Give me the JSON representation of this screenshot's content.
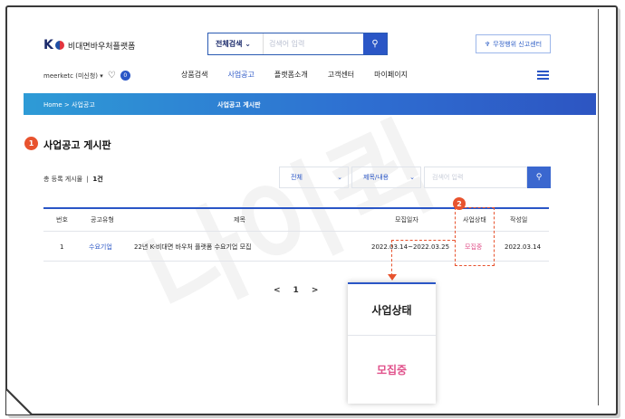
{
  "logo": {
    "text": "비대면바우처플랫폼"
  },
  "search": {
    "select": "전체검색",
    "placeholder": "검색어 입력"
  },
  "report_button": "무정행위 신고센터",
  "user": {
    "name": "meerketc (미신청) ▾",
    "badge": "0"
  },
  "nav": [
    "상품검색",
    "사업공고",
    "플랫폼소개",
    "고객센터",
    "마이페이지"
  ],
  "nav_active_index": 1,
  "breadcrumb": {
    "home": "Home",
    "sep": ">",
    "current": "사업공고",
    "title": "사업공고 게시판"
  },
  "page": {
    "marker": "1",
    "title": "사업공고 게시판"
  },
  "summary": {
    "label": "총 등록 게시물",
    "count": "1건"
  },
  "filters": {
    "scope": "전체",
    "field": "제목/내용",
    "placeholder": "검색어 입력"
  },
  "table": {
    "headers": [
      "번호",
      "공고유형",
      "제목",
      "모집일자",
      "사업상태",
      "작성일"
    ],
    "rows": [
      {
        "no": "1",
        "type": "수요기업",
        "title": "22년 K-비대면 바우처 플랫폼 수요기업 모집",
        "period": "2022.03.14~2022.03.25",
        "status": "모집중",
        "date": "2022.03.14"
      }
    ]
  },
  "pagination": {
    "prev": "<",
    "page": "1",
    "next": ">"
  },
  "callout": {
    "marker": "2",
    "header": "사업상태",
    "value": "모집중"
  },
  "watermark": "나이퀵",
  "colors": {
    "accent": "#2a56c6",
    "marker": "#e8532e",
    "status": "#e0508a"
  }
}
